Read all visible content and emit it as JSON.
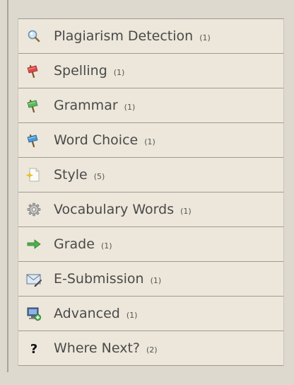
{
  "menu": {
    "items": [
      {
        "label": "Plagiarism Detection",
        "count": "(1)",
        "icon": "magnifier-icon"
      },
      {
        "label": "Spelling",
        "count": "(1)",
        "icon": "red-flag-icon"
      },
      {
        "label": "Grammar",
        "count": "(1)",
        "icon": "green-flag-icon"
      },
      {
        "label": "Word Choice",
        "count": "(1)",
        "icon": "blue-flag-icon"
      },
      {
        "label": "Style",
        "count": "(5)",
        "icon": "document-sparkle-icon"
      },
      {
        "label": "Vocabulary Words",
        "count": "(1)",
        "icon": "gear-icon"
      },
      {
        "label": "Grade",
        "count": "(1)",
        "icon": "green-arrow-icon"
      },
      {
        "label": "E-Submission",
        "count": "(1)",
        "icon": "envelope-icon"
      },
      {
        "label": "Advanced",
        "count": "(1)",
        "icon": "monitor-add-icon"
      },
      {
        "label": "Where Next?",
        "count": "(2)",
        "icon": "question-mark-icon"
      }
    ]
  }
}
